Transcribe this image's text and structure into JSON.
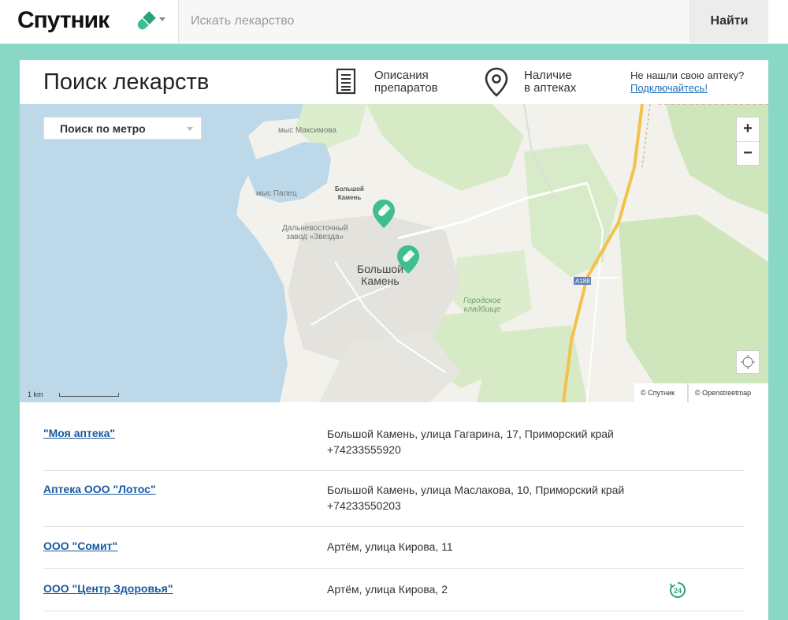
{
  "header": {
    "logo_text": "Спутник",
    "search_placeholder": "Искать лекарство",
    "search_button": "Найти"
  },
  "page": {
    "title": "Поиск лекарств",
    "features": [
      {
        "line1": "Описания",
        "line2": "препаратов",
        "icon": "document-icon"
      },
      {
        "line1": "Наличие",
        "line2": "в аптеках",
        "icon": "map-pin-icon"
      }
    ],
    "connect_question": "Не нашли свою аптеку?",
    "connect_link": "Подключайтесь!"
  },
  "map": {
    "metro_select": "Поиск по метро",
    "zoom_in": "+",
    "zoom_out": "−",
    "scale": "1 km",
    "attribution_1": "© Спутник",
    "attribution_2": "© Openstreetmap",
    "labels": {
      "cape_maksimova": "мыс Максимова",
      "cape_palets": "мыс Палец",
      "station": "Большой\nКамень",
      "zavod": "Дальневосточный\nзавод «Звезда»",
      "town": "Большой\nКамень",
      "cemetery": "Городское\nкладбище",
      "road": "A188"
    }
  },
  "pharmacies": [
    {
      "name": "\"Моя аптека\"",
      "address": "Большой Камень, улица Гагарина, 17, Приморский край",
      "phone": "+74233555920"
    },
    {
      "name": "Аптека ООО \"Лотос\"",
      "address": "Большой Камень, улица Маслакова, 10, Приморский край",
      "phone": "+74233550203"
    },
    {
      "name": "ООО \"Сомит\"",
      "address": "Артём, улица Кирова, 11",
      "phone": ""
    },
    {
      "name": "ООО \"Центр Здоровья\"",
      "address": "Артём, улица Кирова, 2",
      "phone": "",
      "badge": "24"
    }
  ],
  "colors": {
    "accent": "#3fbf8f",
    "background": "#88d8c5",
    "link": "#1a5aa0"
  }
}
